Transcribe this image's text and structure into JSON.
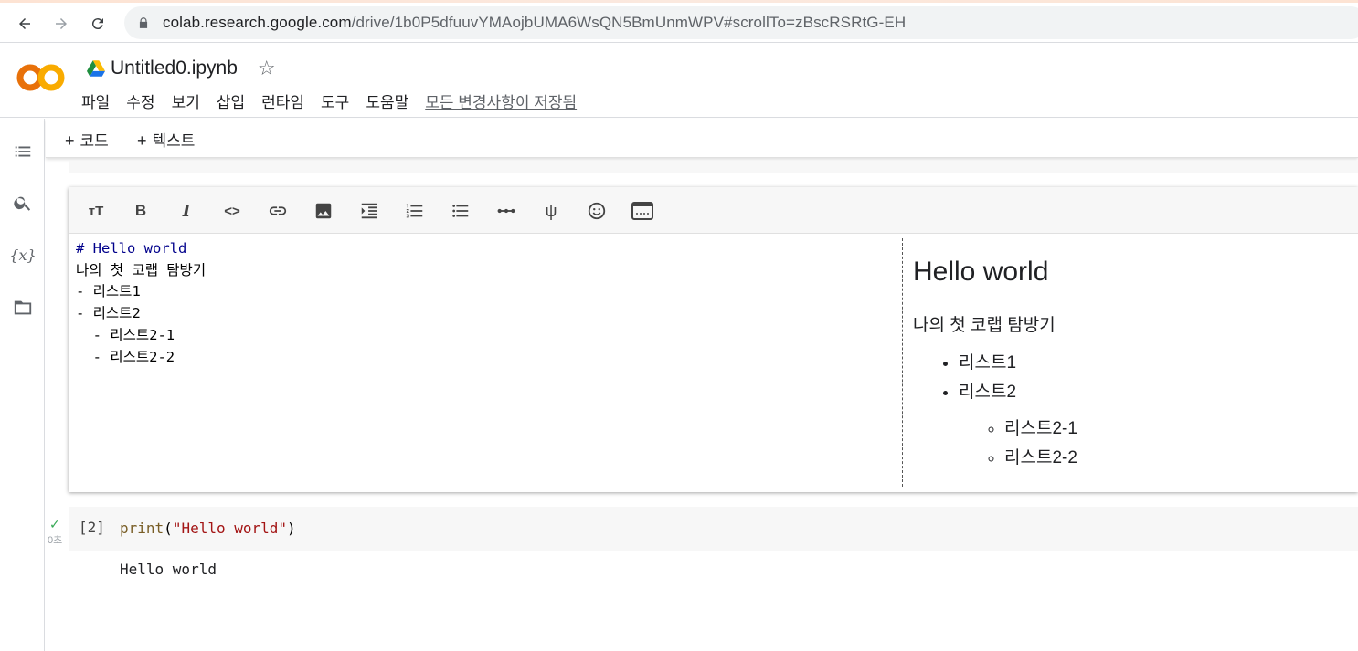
{
  "browser": {
    "url_host": "colab.research.google.com",
    "url_path": "/drive/1b0P5dfuuvYMAojbUMA6WsQN5BmUnmWPV#scrollTo=zBscRSRtG-EH"
  },
  "notebook": {
    "title": "Untitled0.ipynb",
    "menu": [
      "파일",
      "수정",
      "보기",
      "삽입",
      "런타임",
      "도구",
      "도움말"
    ],
    "save_status": "모든 변경사항이 저장됨"
  },
  "toolbar": {
    "add_code": "코드",
    "add_text": "텍스트"
  },
  "text_cell": {
    "source_lines": [
      {
        "text": "# Hello world",
        "kind": "hdr"
      },
      {
        "text": "나의 첫 코랩 탐방기",
        "kind": "plain"
      },
      {
        "text": "- 리스트1",
        "kind": "list"
      },
      {
        "text": "- 리스트2",
        "kind": "list"
      },
      {
        "text": "  - 리스트2-1",
        "kind": "list"
      },
      {
        "text": "  - 리스트2-2",
        "kind": "list"
      }
    ],
    "preview": {
      "heading": "Hello world",
      "paragraph": "나의 첫 코랩 탐방기",
      "items": [
        "리스트1",
        "리스트2"
      ],
      "subitems": [
        "리스트2-1",
        "리스트2-2"
      ]
    }
  },
  "code_cell": {
    "exec_count": "[2]",
    "exec_time": "0초",
    "code_fn": "print",
    "code_open": "(",
    "code_str": "\"Hello world\"",
    "code_close": ")",
    "output": "Hello world"
  },
  "colors": {
    "check": "#34a853",
    "logo_orange": "#f9ab00",
    "logo_dark_orange": "#e8710a"
  }
}
